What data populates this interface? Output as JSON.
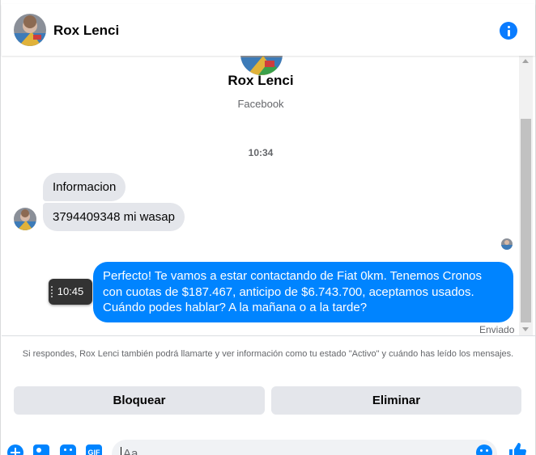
{
  "header": {
    "name": "Rox Lenci",
    "info_icon": "info-icon"
  },
  "profile": {
    "name": "Rox Lenci",
    "subtitle": "Facebook"
  },
  "thread": {
    "time_separator": "10:34",
    "incoming": [
      {
        "text": "Informacion"
      },
      {
        "text": "3794409348 mi wasap"
      }
    ],
    "outgoing": [
      {
        "text": "Perfecto! Te vamos a estar contactando de Fiat 0km. Tenemos Cronos con cuotas de $187.467, anticipo de $6.743.700, aceptamos usados. Cuándo podes hablar? A la mañana o a la tarde?"
      }
    ],
    "tooltip_time": "10:45",
    "status": "Enviado"
  },
  "notice": {
    "text": "Si respondes, Rox Lenci también podrá llamarte y ver información como tu estado \"Activo\" y cuándo has leído los mensajes."
  },
  "actions": {
    "block_label": "Bloquear",
    "delete_label": "Eliminar"
  },
  "composer": {
    "placeholder": "Aa",
    "gif_label": "GIF",
    "icons": [
      "plus-icon",
      "photo-icon",
      "sticker-icon",
      "gif-icon",
      "emoji-icon",
      "like-icon"
    ]
  },
  "colors": {
    "accent": "#0084ff",
    "incoming_bubble": "#e4e6eb",
    "secondary_text": "#65676b"
  }
}
